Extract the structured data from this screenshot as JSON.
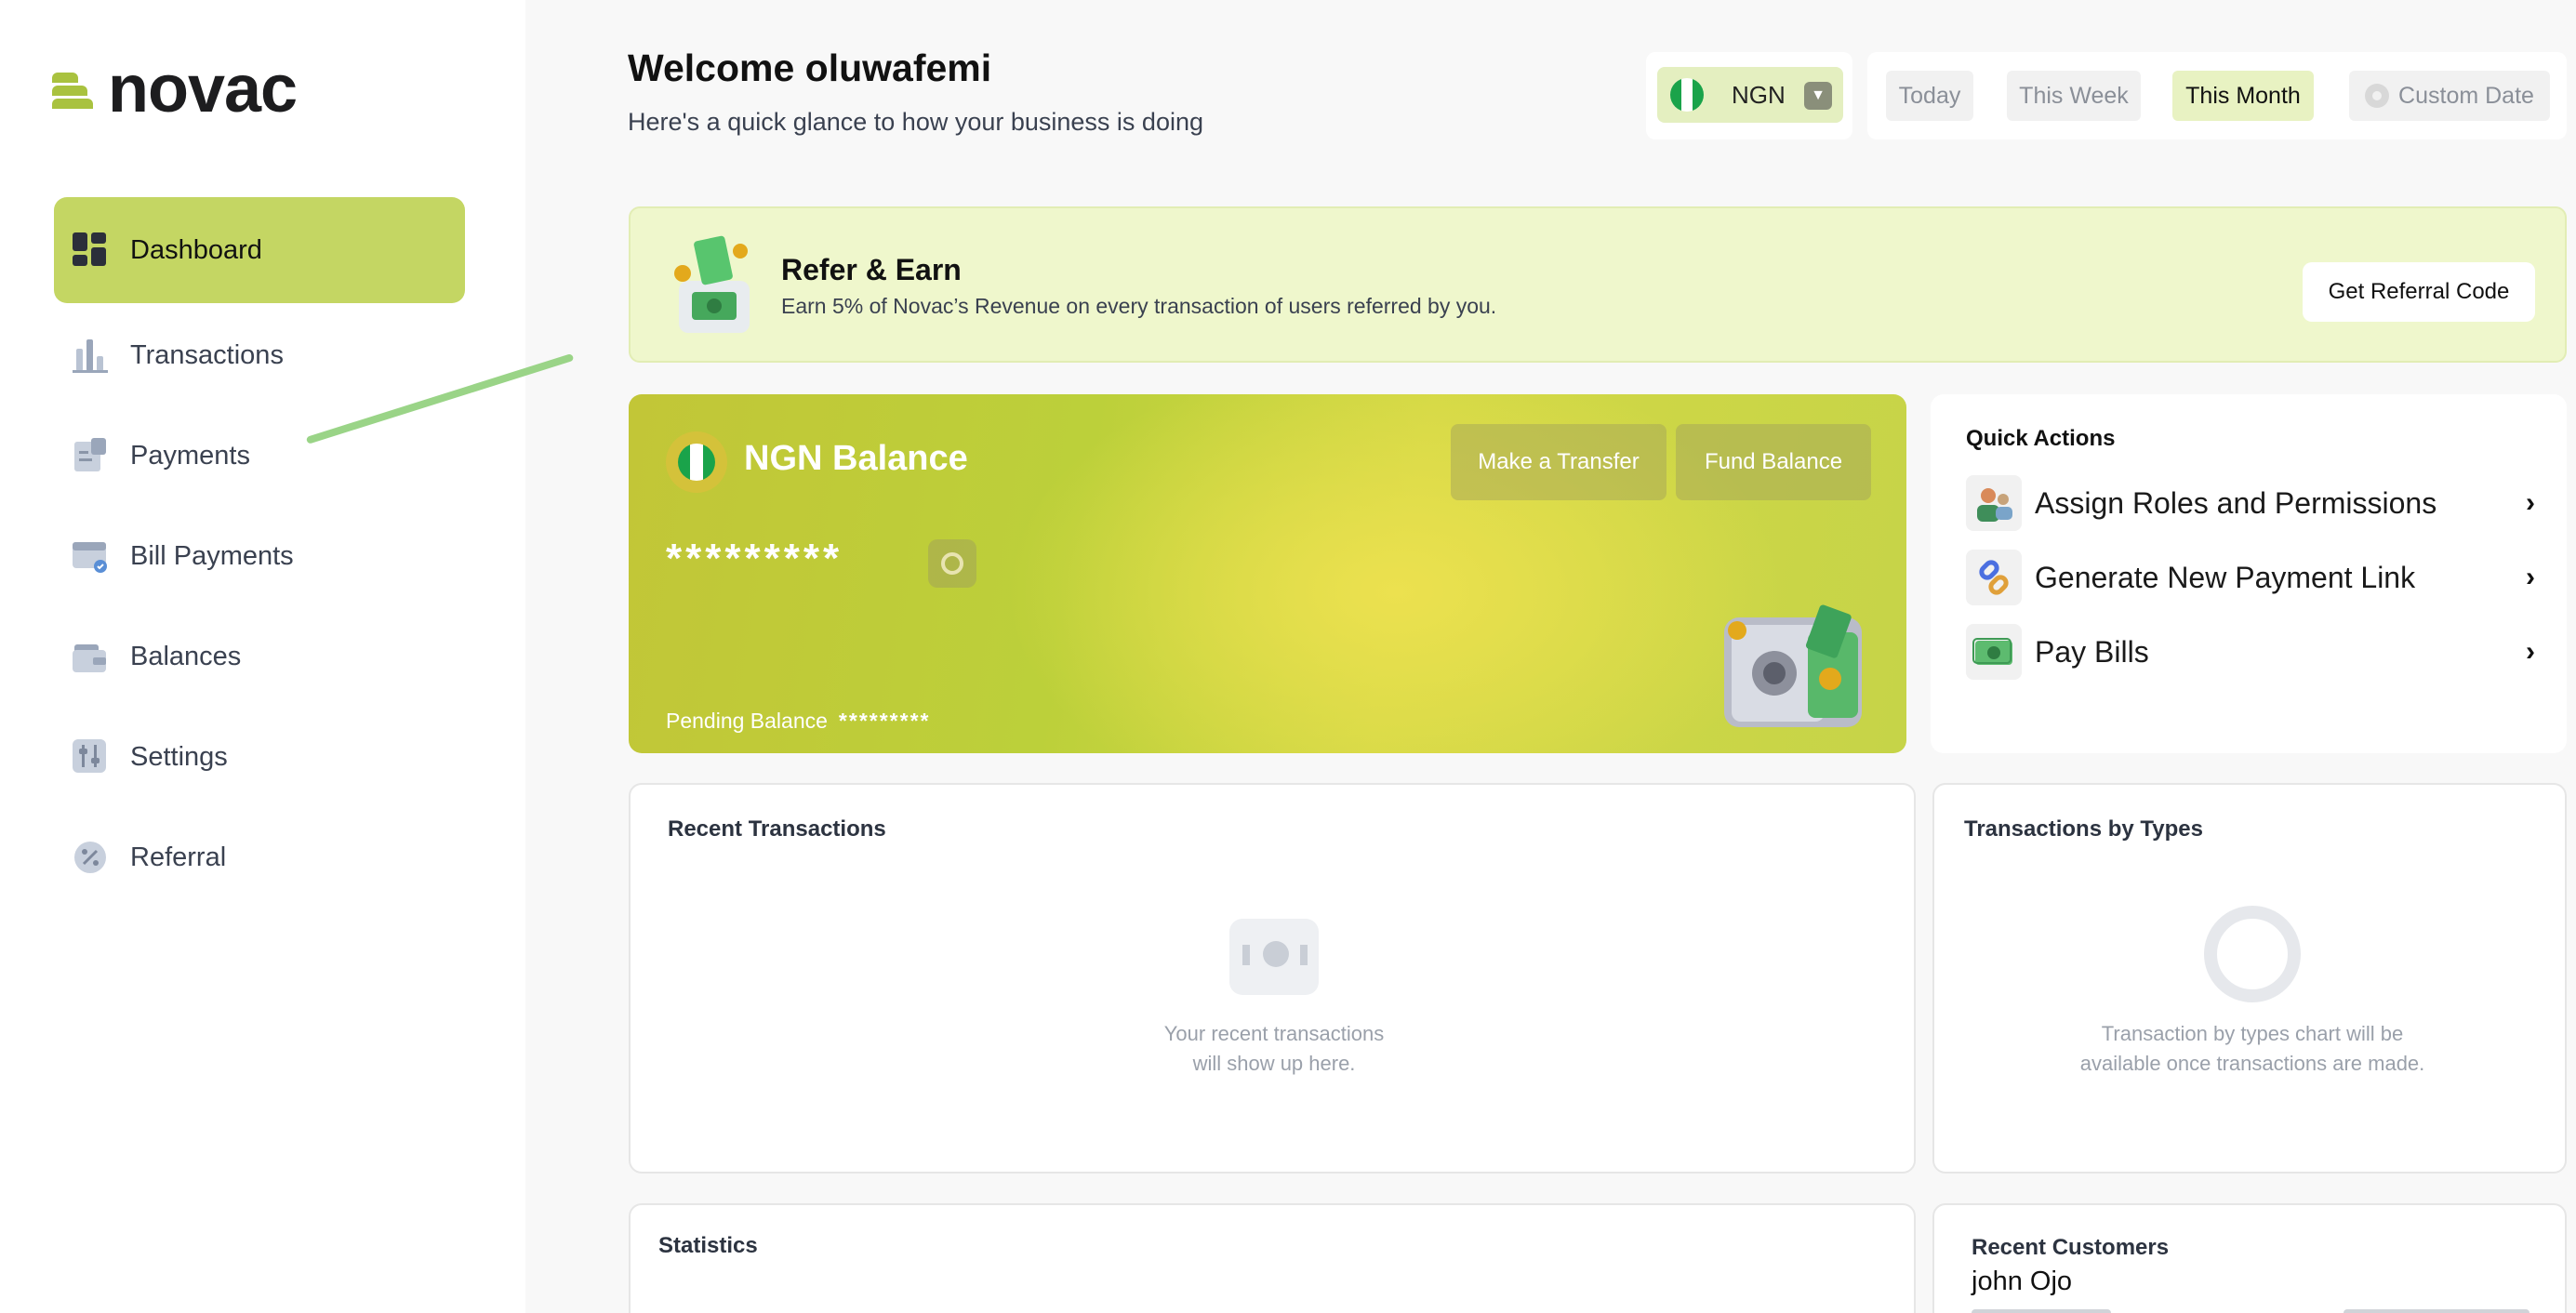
{
  "brand": {
    "name": "novac",
    "accent": "#c4d663"
  },
  "sidebar": {
    "items": [
      {
        "label": "Dashboard",
        "icon": "dashboard-icon",
        "active": true
      },
      {
        "label": "Transactions",
        "icon": "bar-chart-icon"
      },
      {
        "label": "Payments",
        "icon": "receipt-icon"
      },
      {
        "label": "Bill Payments",
        "icon": "bill-icon"
      },
      {
        "label": "Balances",
        "icon": "wallet-icon"
      },
      {
        "label": "Settings",
        "icon": "sliders-icon"
      },
      {
        "label": "Referral",
        "icon": "percent-badge-icon"
      }
    ]
  },
  "header": {
    "title": "Welcome oluwafemi",
    "subtitle": "Here's a quick glance to how your business is doing",
    "currency": "NGN",
    "periods": [
      "Today",
      "This Week",
      "This Month",
      "Custom Date"
    ],
    "active_period": "This Month"
  },
  "referral": {
    "title": "Refer & Earn",
    "subtitle": "Earn 5% of Novac’s Revenue on every transaction of users referred by you.",
    "button": "Get Referral Code"
  },
  "balance": {
    "title": "NGN Balance",
    "masked_amount": "*********",
    "pending_label": "Pending Balance",
    "pending_masked": "*********",
    "transfer_button": "Make a Transfer",
    "fund_button": "Fund Balance"
  },
  "quick_actions": {
    "title": "Quick Actions",
    "items": [
      {
        "label": "Assign Roles and Permissions",
        "icon": "users-roles-icon"
      },
      {
        "label": "Generate New Payment Link",
        "icon": "link-icon"
      },
      {
        "label": "Pay Bills",
        "icon": "cash-icon"
      }
    ]
  },
  "recent_transactions": {
    "title": "Recent Transactions",
    "empty_line1": "Your recent transactions",
    "empty_line2": "will show up here."
  },
  "transactions_by_types": {
    "title": "Transactions by Types",
    "empty_line1": "Transaction by types chart will be",
    "empty_line2": "available once transactions are made."
  },
  "statistics": {
    "title": "Statistics"
  },
  "recent_customers": {
    "title": "Recent Customers",
    "first_name": "john Ojo"
  }
}
